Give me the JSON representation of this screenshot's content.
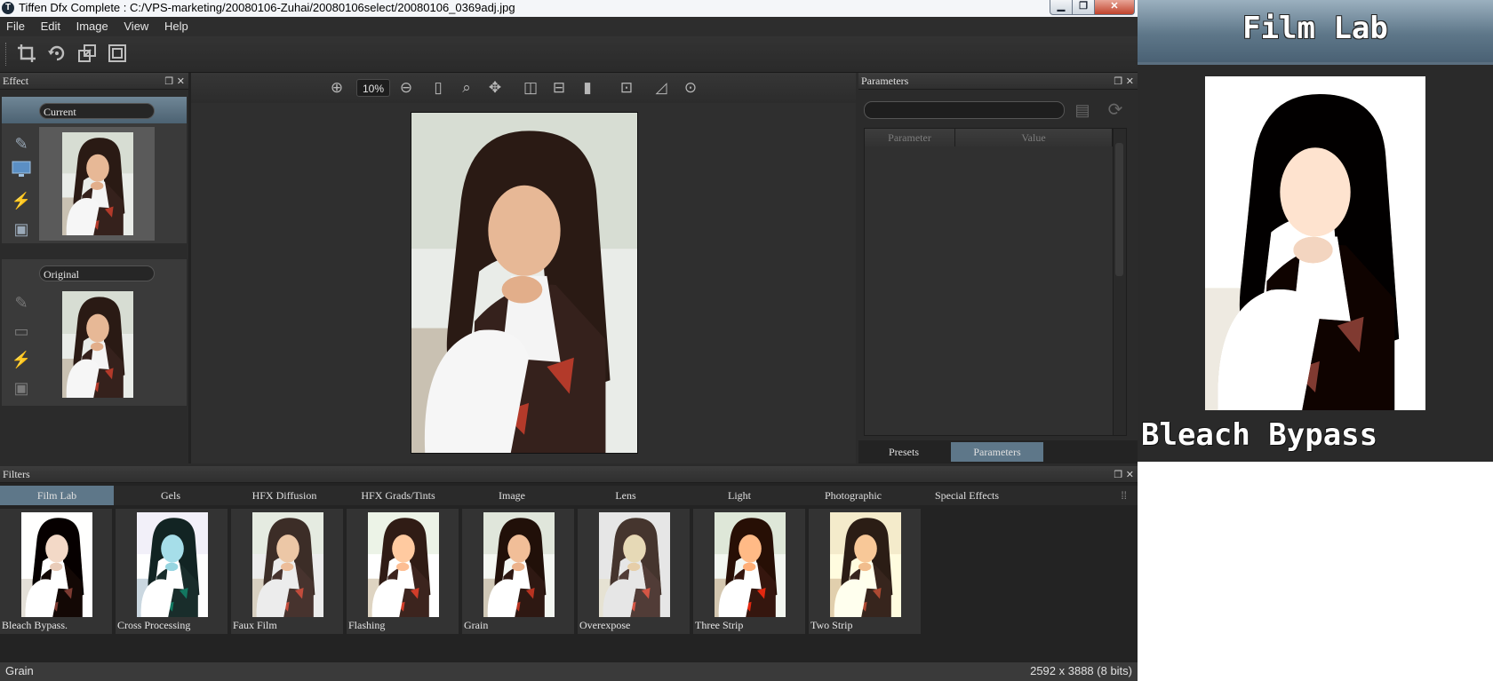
{
  "window": {
    "app_icon": "tiffen-logo-icon",
    "title": "Tiffen Dfx Complete : C:/VPS-marketing/20080106-Zuhai/20080106select/20080106_0369adj.jpg",
    "controls": [
      "minimize-icon",
      "maximize-icon",
      "close-icon"
    ]
  },
  "menu": [
    "File",
    "Edit",
    "Image",
    "View",
    "Help"
  ],
  "toolbar": [
    "crop-icon",
    "rotate-icon",
    "resize-icon",
    "fit-icon"
  ],
  "effect_panel": {
    "title": "Effect",
    "current_label": "Current",
    "original_label": "Original",
    "side_icons": [
      "edit-image-icon",
      "monitor-icon",
      "lightning-icon",
      "image-frame-icon"
    ]
  },
  "viewer": {
    "zoom_value": "10%",
    "icons": [
      "zoom-in-icon",
      "zoom-out-icon",
      "single-view-icon",
      "magnifier-icon",
      "pan-icon",
      "split-vertical-icon",
      "split-horizontal-icon",
      "full-view-icon",
      "fit-screen-icon",
      "histogram-icon",
      "loupe-icon"
    ]
  },
  "parameters_panel": {
    "title": "Parameters",
    "columns": [
      "Parameter",
      "Value"
    ],
    "tabs": [
      "Presets",
      "Parameters"
    ],
    "active_tab": "Parameters"
  },
  "filters_panel": {
    "title": "Filters",
    "categories": [
      "Film Lab",
      "Gels",
      "HFX Diffusion",
      "HFX Grads/Tints",
      "Image",
      "Lens",
      "Light",
      "Photographic",
      "Special Effects"
    ],
    "active_category": "Film Lab",
    "items": [
      "Bleach Bypass.",
      "Cross Processing",
      "Faux Film",
      "Flashing",
      "Grain",
      "Overexpose",
      "Three Strip",
      "Two Strip"
    ]
  },
  "status": {
    "left": "Grain",
    "right": "2592 x 3888 (8 bits)"
  },
  "preview_overlay": {
    "title": "Film Lab",
    "caption": "Bleach Bypass"
  },
  "colors": {
    "app_bg": "#2b2b2b",
    "active_tab": "#5e7789",
    "preview_header": "#5e7789"
  }
}
